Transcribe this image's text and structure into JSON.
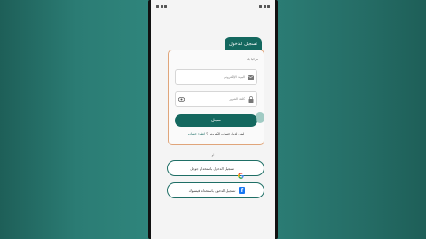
{
  "form": {
    "title": "تسجيل الدخول",
    "welcome": "مرحبا بك",
    "email_placeholder": "البريد الإلكتروني",
    "password_placeholder": "كلمة المرور",
    "submit_label": "سجل",
    "signup_prompt": "ليس لديك حساب الكتروني ؟",
    "signup_link": "انشئ حساب"
  },
  "divider_text": "او",
  "social": {
    "google_label": "تسجيل الدخول باستخدام جوجل",
    "facebook_label": "تسجيل الدخول باستخدام فيسبوك"
  },
  "colors": {
    "primary": "#14685f",
    "card_border": "#e0a57a",
    "background": "#2b7c74"
  }
}
